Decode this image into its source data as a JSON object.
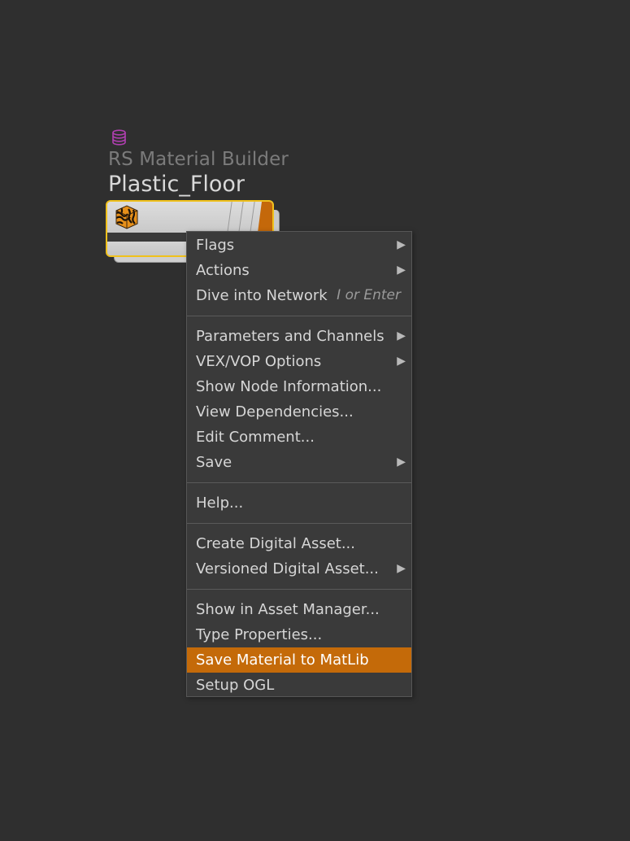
{
  "node": {
    "type_label": "RS Material Builder",
    "name": "Plastic_Floor",
    "type_icon": "database-icon",
    "node_icon": "tiger-stripe-material-icon",
    "accent_color": "#f0c11c",
    "flag_color": "#c4680a"
  },
  "context_menu": {
    "highlight_color": "#c46a09",
    "groups": [
      [
        {
          "label": "Flags",
          "submenu": true
        },
        {
          "label": "Actions",
          "submenu": true
        },
        {
          "label": "Dive into Network",
          "shortcut": "I or Enter"
        }
      ],
      [
        {
          "label": "Parameters and Channels",
          "submenu": true
        },
        {
          "label": "VEX/VOP Options",
          "submenu": true
        },
        {
          "label": "Show Node Information..."
        },
        {
          "label": "View Dependencies..."
        },
        {
          "label": "Edit Comment..."
        },
        {
          "label": "Save",
          "submenu": true
        }
      ],
      [
        {
          "label": "Help..."
        }
      ],
      [
        {
          "label": "Create Digital Asset..."
        },
        {
          "label": "Versioned Digital Asset...",
          "submenu": true
        }
      ],
      [
        {
          "label": "Show in Asset Manager..."
        },
        {
          "label": "Type Properties..."
        },
        {
          "label": "Save Material to MatLib",
          "active": true
        },
        {
          "label": "Setup OGL"
        }
      ]
    ],
    "submenu_arrow": "▶"
  }
}
